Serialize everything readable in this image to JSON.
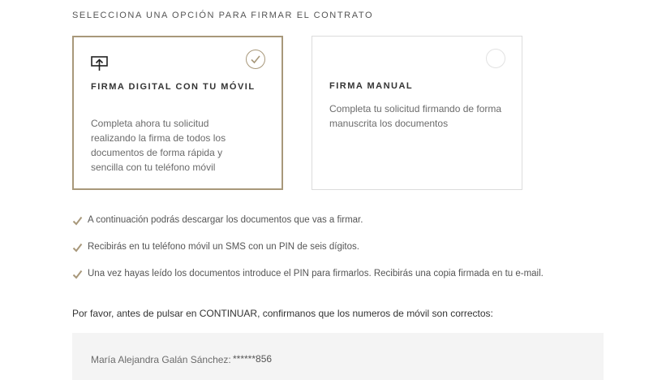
{
  "section_title": "SELECCIONA UNA OPCIÓN PARA FIRMAR EL CONTRATO",
  "options": [
    {
      "title": "FIRMA DIGITAL CON TU MÓVIL",
      "description": "Completa ahora tu solicitud realizando la firma de todos los documentos de forma rápida y sencilla con tu teléfono móvil",
      "selected": true,
      "icon": "mobile-sign-icon"
    },
    {
      "title": "FIRMA MANUAL",
      "description": "Completa tu solicitud firmando de forma manuscrita los documentos",
      "selected": false
    }
  ],
  "info_items": [
    "A continuación podrás descargar los documentos que vas a firmar.",
    "Recibirás en tu teléfono móvil un SMS con un PIN de seis dígitos.",
    "Una vez hayas leído los documentos introduce el PIN para firmarlos. Recibirás una copia firmada en tu e-mail."
  ],
  "confirm_text": "Por favor, antes de pulsar en CONTINUAR, confirmanos que los numeros de móvil son correctos:",
  "phone": {
    "name": "María Alejandra Galán Sánchez:",
    "number": "******856"
  },
  "colors": {
    "accent": "#a8987a",
    "border": "#dcdcdc",
    "box_bg": "#f4f4f4"
  }
}
